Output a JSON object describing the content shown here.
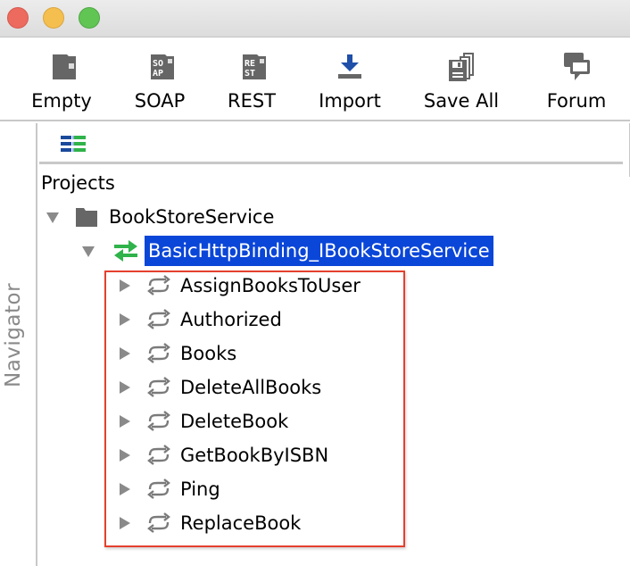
{
  "window": {
    "controls": [
      "close",
      "minimize",
      "zoom"
    ]
  },
  "toolbar": {
    "buttons": [
      {
        "label": "Empty",
        "icon": "empty-project-icon"
      },
      {
        "label": "SOAP",
        "icon": "soap-project-icon",
        "glyph": "SO AP"
      },
      {
        "label": "REST",
        "icon": "rest-project-icon",
        "glyph": "RE ST"
      },
      {
        "label": "Import",
        "icon": "import-icon"
      },
      {
        "label": "Save All",
        "icon": "save-all-icon"
      },
      {
        "label": "Forum",
        "icon": "forum-icon"
      }
    ]
  },
  "navigator": {
    "label": "Navigator",
    "view_icon": "list-view-icon",
    "root_label": "Projects",
    "project": {
      "name": "BookStoreService",
      "expanded": true,
      "interface": {
        "name": "BasicHttpBinding_IBookStoreService",
        "selected": true,
        "expanded": true,
        "operations": [
          "AssignBooksToUser",
          "Authorized",
          "Books",
          "DeleteAllBooks",
          "DeleteBook",
          "GetBookByISBN",
          "Ping",
          "ReplaceBook"
        ]
      }
    }
  },
  "colors": {
    "selection": "#0a46d8",
    "highlight_border": "#e5402e",
    "icon_gray": "#666666",
    "import_blue": "#1f4fa8",
    "interface_green": "#2fb34a"
  }
}
